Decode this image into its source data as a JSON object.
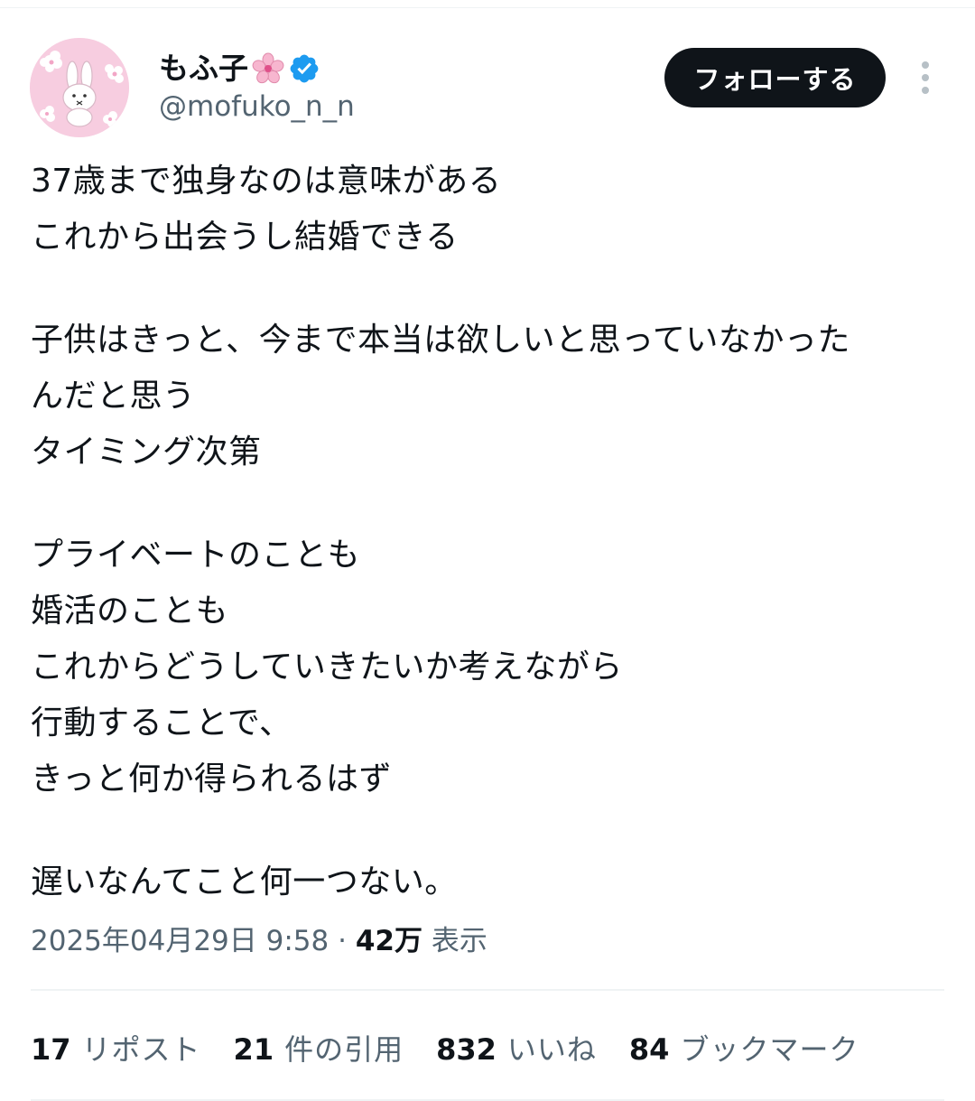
{
  "user": {
    "display_name": "もふ子",
    "handle": "@mofuko_n_n",
    "avatar_icon": "rabbit-avatar",
    "name_emoji": "cherry-blossom-icon",
    "verified_icon": "verified-badge-icon",
    "verified_color": "#1d9bf0"
  },
  "actions": {
    "follow_label": "フォローする",
    "more_icon": "more-dots-icon"
  },
  "tweet": {
    "lines": [
      "37歳まで独身なのは意味がある",
      "これから出会うし結婚できる",
      "",
      "子供はきっと、今まで本当は欲しいと思っていなかった",
      "んだと思う",
      "タイミング次第",
      "",
      "プライベートのことも",
      "婚活のことも",
      "これからどうしていきたいか考えながら",
      "行動することで、",
      "きっと何か得られるはず",
      "",
      "遅いなんてこと何一つない。"
    ]
  },
  "meta": {
    "timestamp": "2025年04月29日 9:58",
    "separator": " · ",
    "views_count": "42万",
    "views_label": " 表示"
  },
  "stats": [
    {
      "count": "17",
      "label": "リポスト"
    },
    {
      "count": "21",
      "label": "件の引用"
    },
    {
      "count": "832",
      "label": "いいね"
    },
    {
      "count": "84",
      "label": "ブックマーク"
    }
  ],
  "colors": {
    "text": "#0f1419",
    "secondary": "#536471",
    "avatar_bg": "#f6cfe0",
    "button_bg": "#0f1419"
  }
}
